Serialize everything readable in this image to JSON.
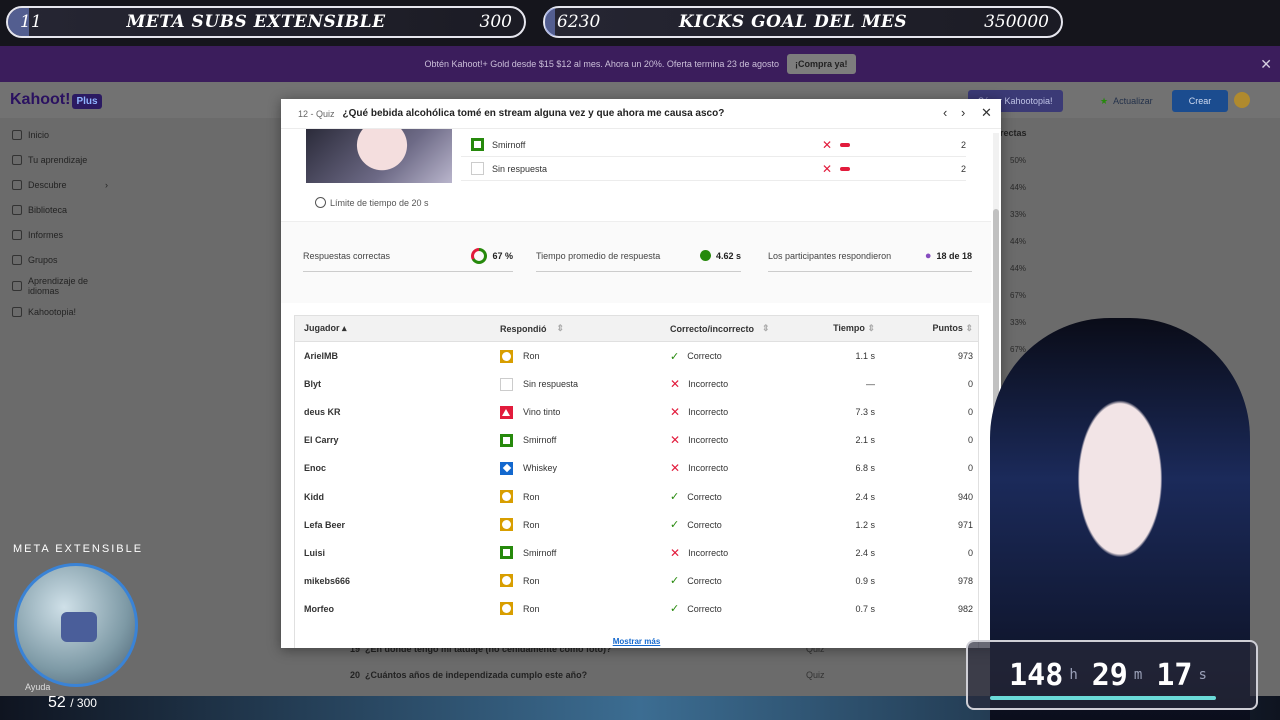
{
  "overlay": {
    "goal1": {
      "left": "11",
      "title": "META SUBS EXTENSIBLE",
      "right": "300",
      "fill_fraction": 0.04
    },
    "goal2": {
      "left": "6230",
      "title": "KICKS GOAL DEL MES",
      "right": "350000",
      "fill_fraction": 0.02
    }
  },
  "promo": {
    "text": "Obtén Kahoot!+ Gold desde $15 $12 al mes. Ahora un 20%. Oferta termina 23 de agosto",
    "button": "¡Compra ya!"
  },
  "nav": {
    "logo": "Kahoot!",
    "plus": "Plus",
    "kahootopia_btn": "Súper Kahootopia!",
    "update_btn": "Actualizar",
    "create_btn": "Crear"
  },
  "sidebar": {
    "items": [
      "Inicio",
      "Tu aprendizaje",
      "Descubre",
      "Biblioteca",
      "Informes",
      "Grupos",
      "Aprendizaje de idiomas",
      "Kahootopia!"
    ],
    "help": "Ayuda"
  },
  "background": {
    "col_title": "rectas",
    "pcts": [
      "50%",
      "44%",
      "33%",
      "44%",
      "44%",
      "67%",
      "33%",
      "67%"
    ],
    "row19": {
      "num": "19",
      "question": "¿En dónde tengo mi tatuaje (no ceñidamente como foto)?",
      "type": "Quiz"
    },
    "row20": {
      "num": "20",
      "question": "¿Cuántos años de independizada cumplo este año?",
      "type": "Quiz"
    }
  },
  "modal": {
    "number": "12 - Quiz",
    "question": "¿Qué bebida alcohólica tomé en stream alguna vez y que ahora me causa asco?",
    "answers": [
      {
        "label": "Smirnoff",
        "count": "2"
      },
      {
        "label": "Sin respuesta",
        "count": "2"
      }
    ],
    "time_limit": "Límite de tiempo de 20 s",
    "stats": {
      "correct_label": "Respuestas correctas",
      "correct_value": "67 %",
      "avg_label": "Tiempo promedio de respuesta",
      "avg_value": "4.62 s",
      "participants_label": "Los participantes respondieron",
      "participants_value": "18 de 18"
    },
    "table": {
      "headers": [
        "Jugador",
        "Respondió",
        "Correcto/incorrecto",
        "Tiempo",
        "Puntos"
      ],
      "rows": [
        {
          "player": "ArielMB",
          "answer": "Ron",
          "shape": "circle",
          "result": "Correcto",
          "ok": true,
          "time": "1.1 s",
          "points": "973"
        },
        {
          "player": "Blyt",
          "answer": "Sin respuesta",
          "shape": "none",
          "result": "Incorrecto",
          "ok": false,
          "time": "—",
          "points": "0"
        },
        {
          "player": "deus KR",
          "answer": "Vino tinto",
          "shape": "triangle",
          "result": "Incorrecto",
          "ok": false,
          "time": "7.3 s",
          "points": "0"
        },
        {
          "player": "El Carry",
          "answer": "Smirnoff",
          "shape": "square",
          "result": "Incorrecto",
          "ok": false,
          "time": "2.1 s",
          "points": "0"
        },
        {
          "player": "Enoc",
          "answer": "Whiskey",
          "shape": "diamond",
          "result": "Incorrecto",
          "ok": false,
          "time": "6.8 s",
          "points": "0"
        },
        {
          "player": "Kidd",
          "answer": "Ron",
          "shape": "circle",
          "result": "Correcto",
          "ok": true,
          "time": "2.4 s",
          "points": "940"
        },
        {
          "player": "Lefa Beer",
          "answer": "Ron",
          "shape": "circle",
          "result": "Correcto",
          "ok": true,
          "time": "1.2 s",
          "points": "971"
        },
        {
          "player": "Luisi",
          "answer": "Smirnoff",
          "shape": "square",
          "result": "Incorrecto",
          "ok": false,
          "time": "2.4 s",
          "points": "0"
        },
        {
          "player": "mikebs666",
          "answer": "Ron",
          "shape": "circle",
          "result": "Correcto",
          "ok": true,
          "time": "0.9 s",
          "points": "978"
        },
        {
          "player": "Morfeo",
          "answer": "Ron",
          "shape": "circle",
          "result": "Correcto",
          "ok": true,
          "time": "0.7 s",
          "points": "982"
        }
      ],
      "show_more": "Mostrar más"
    }
  },
  "stream": {
    "meta_title": "META EXTENSIBLE",
    "meta_count": "52",
    "meta_total": "/ 300",
    "timer": {
      "h": "148",
      "h_unit": "h",
      "m": "29",
      "m_unit": "m",
      "s": "17",
      "s_unit": "s"
    }
  }
}
